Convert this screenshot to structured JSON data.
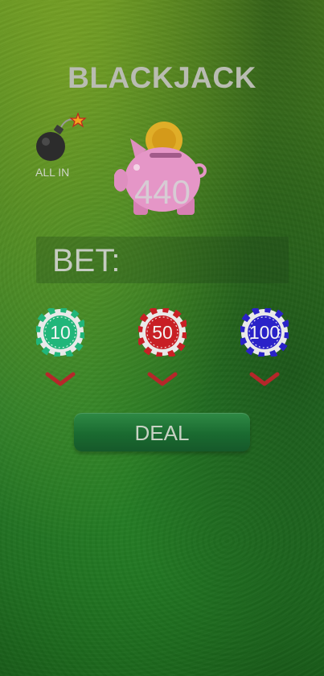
{
  "title": "BLACKJACK",
  "all_in": {
    "label": "ALL IN",
    "icon": "bomb-icon"
  },
  "bank": {
    "amount": "440",
    "icon": "piggy-bank-icon"
  },
  "bet": {
    "label": "BET:",
    "value": ""
  },
  "chips": [
    {
      "value": "10",
      "color": "#21b67a",
      "remove_icon": "chevron-down-icon"
    },
    {
      "value": "50",
      "color": "#c81f25",
      "remove_icon": "chevron-down-icon"
    },
    {
      "value": "100",
      "color": "#2a22c8",
      "remove_icon": "chevron-down-icon"
    }
  ],
  "deal_button": {
    "label": "DEAL"
  },
  "colors": {
    "chevron": "#b5272a",
    "piggy": "#e596c7",
    "coin": "#e5b52a"
  }
}
